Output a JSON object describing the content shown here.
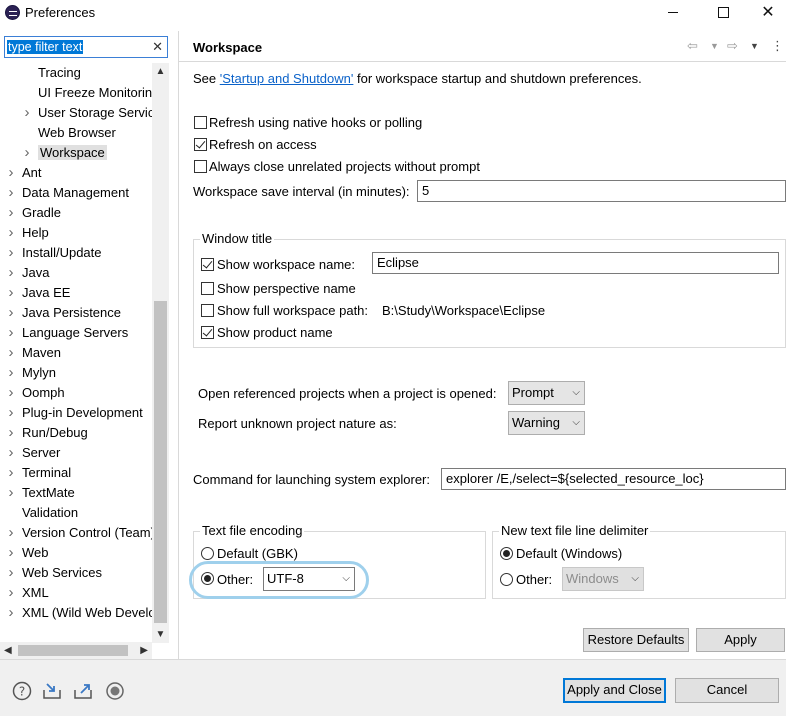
{
  "window": {
    "title": "Preferences",
    "minimize": "",
    "maximize": "",
    "close": "✕"
  },
  "filter": {
    "placeholder": "type filter text",
    "value": "type filter text",
    "clear": "✕"
  },
  "tree": {
    "items": [
      {
        "label": "Tracing",
        "level": 2,
        "expandable": false,
        "selected": false
      },
      {
        "label": "UI Freeze Monitoring",
        "level": 2,
        "expandable": false,
        "selected": false
      },
      {
        "label": "User Storage Service",
        "level": 2,
        "expandable": true,
        "selected": false
      },
      {
        "label": "Web Browser",
        "level": 2,
        "expandable": false,
        "selected": false
      },
      {
        "label": "Workspace",
        "level": 2,
        "expandable": true,
        "selected": true
      },
      {
        "label": "Ant",
        "level": 1,
        "expandable": true,
        "selected": false
      },
      {
        "label": "Data Management",
        "level": 1,
        "expandable": true,
        "selected": false
      },
      {
        "label": "Gradle",
        "level": 1,
        "expandable": true,
        "selected": false
      },
      {
        "label": "Help",
        "level": 1,
        "expandable": true,
        "selected": false
      },
      {
        "label": "Install/Update",
        "level": 1,
        "expandable": true,
        "selected": false
      },
      {
        "label": "Java",
        "level": 1,
        "expandable": true,
        "selected": false
      },
      {
        "label": "Java EE",
        "level": 1,
        "expandable": true,
        "selected": false
      },
      {
        "label": "Java Persistence",
        "level": 1,
        "expandable": true,
        "selected": false
      },
      {
        "label": "Language Servers",
        "level": 1,
        "expandable": true,
        "selected": false
      },
      {
        "label": "Maven",
        "level": 1,
        "expandable": true,
        "selected": false
      },
      {
        "label": "Mylyn",
        "level": 1,
        "expandable": true,
        "selected": false
      },
      {
        "label": "Oomph",
        "level": 1,
        "expandable": true,
        "selected": false
      },
      {
        "label": "Plug-in Development",
        "level": 1,
        "expandable": true,
        "selected": false
      },
      {
        "label": "Run/Debug",
        "level": 1,
        "expandable": true,
        "selected": false
      },
      {
        "label": "Server",
        "level": 1,
        "expandable": true,
        "selected": false
      },
      {
        "label": "Terminal",
        "level": 1,
        "expandable": true,
        "selected": false
      },
      {
        "label": "TextMate",
        "level": 1,
        "expandable": true,
        "selected": false
      },
      {
        "label": "Validation",
        "level": 1,
        "expandable": false,
        "selected": false
      },
      {
        "label": "Version Control (Team)",
        "level": 1,
        "expandable": true,
        "selected": false
      },
      {
        "label": "Web",
        "level": 1,
        "expandable": true,
        "selected": false
      },
      {
        "label": "Web Services",
        "level": 1,
        "expandable": true,
        "selected": false
      },
      {
        "label": "XML",
        "level": 1,
        "expandable": true,
        "selected": false
      },
      {
        "label": "XML (Wild Web Developer)",
        "level": 1,
        "expandable": true,
        "selected": false
      }
    ]
  },
  "page": {
    "title": "Workspace",
    "link_prefix": "See ",
    "link_text": "'Startup and Shutdown'",
    "link_suffix": " for workspace startup and shutdown preferences.",
    "refresh_native": {
      "label": "Refresh using native hooks or polling",
      "checked": false
    },
    "refresh_access": {
      "label": "Refresh on access",
      "checked": true
    },
    "close_unrelated": {
      "label": "Always close unrelated projects without prompt",
      "checked": false
    },
    "save_interval": {
      "label": "Workspace save interval (in minutes):",
      "value": "5"
    },
    "window_title": {
      "group_label": "Window title",
      "show_ws_name": {
        "label": "Show workspace name:",
        "checked": true,
        "value": "Eclipse"
      },
      "show_perspective": {
        "label": "Show perspective name",
        "checked": false
      },
      "show_full_path": {
        "label": "Show full workspace path:",
        "checked": false,
        "value": "B:\\Study\\Workspace\\Eclipse"
      },
      "show_product": {
        "label": "Show product name",
        "checked": true
      }
    },
    "open_referenced": {
      "label": "Open referenced projects when a project is opened:",
      "value": "Prompt"
    },
    "unknown_nature": {
      "label": "Report unknown project nature as:",
      "value": "Warning"
    },
    "explorer_cmd": {
      "label": "Command for launching system explorer:",
      "value": "explorer /E,/select=${selected_resource_loc}"
    },
    "encoding": {
      "group_label": "Text file encoding",
      "default_label": "Default (GBK)",
      "default_checked": false,
      "other_label": "Other:",
      "other_checked": true,
      "other_value": "UTF-8"
    },
    "delimiter": {
      "group_label": "New text file line delimiter",
      "default_label": "Default (Windows)",
      "default_checked": true,
      "other_label": "Other:",
      "other_checked": false,
      "other_value": "Windows"
    },
    "restore_defaults": "Restore Defaults",
    "apply": "Apply"
  },
  "footer": {
    "apply_close": "Apply and Close",
    "cancel": "Cancel",
    "icons": [
      "help-icon",
      "import-icon",
      "export-icon",
      "record-icon"
    ]
  }
}
